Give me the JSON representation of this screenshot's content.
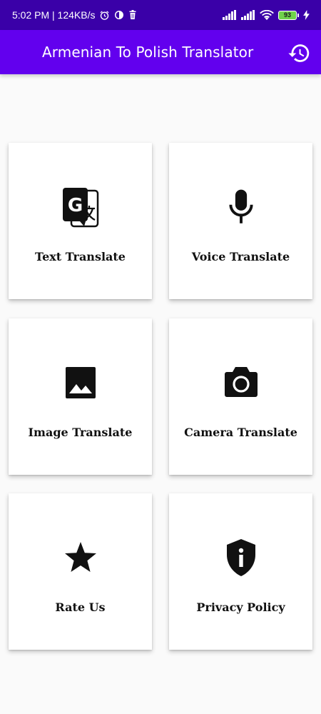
{
  "status_bar": {
    "time_speed": "5:02 PM | 124KB/s",
    "battery": "93"
  },
  "app_bar": {
    "title": "Armenian To Polish Translator",
    "history_icon": "history-icon"
  },
  "cards": [
    {
      "label": "Text Translate",
      "icon": "google-translate-icon"
    },
    {
      "label": "Voice Translate",
      "icon": "microphone-icon"
    },
    {
      "label": "Image Translate",
      "icon": "image-icon"
    },
    {
      "label": "Camera Translate",
      "icon": "camera-icon"
    },
    {
      "label": "Rate Us",
      "icon": "star-icon"
    },
    {
      "label": "Privacy Policy",
      "icon": "privacy-shield-icon"
    }
  ],
  "colors": {
    "status_bar": "#3a00a8",
    "app_bar": "#6200ee",
    "background": "#fafafa",
    "card": "#ffffff"
  }
}
